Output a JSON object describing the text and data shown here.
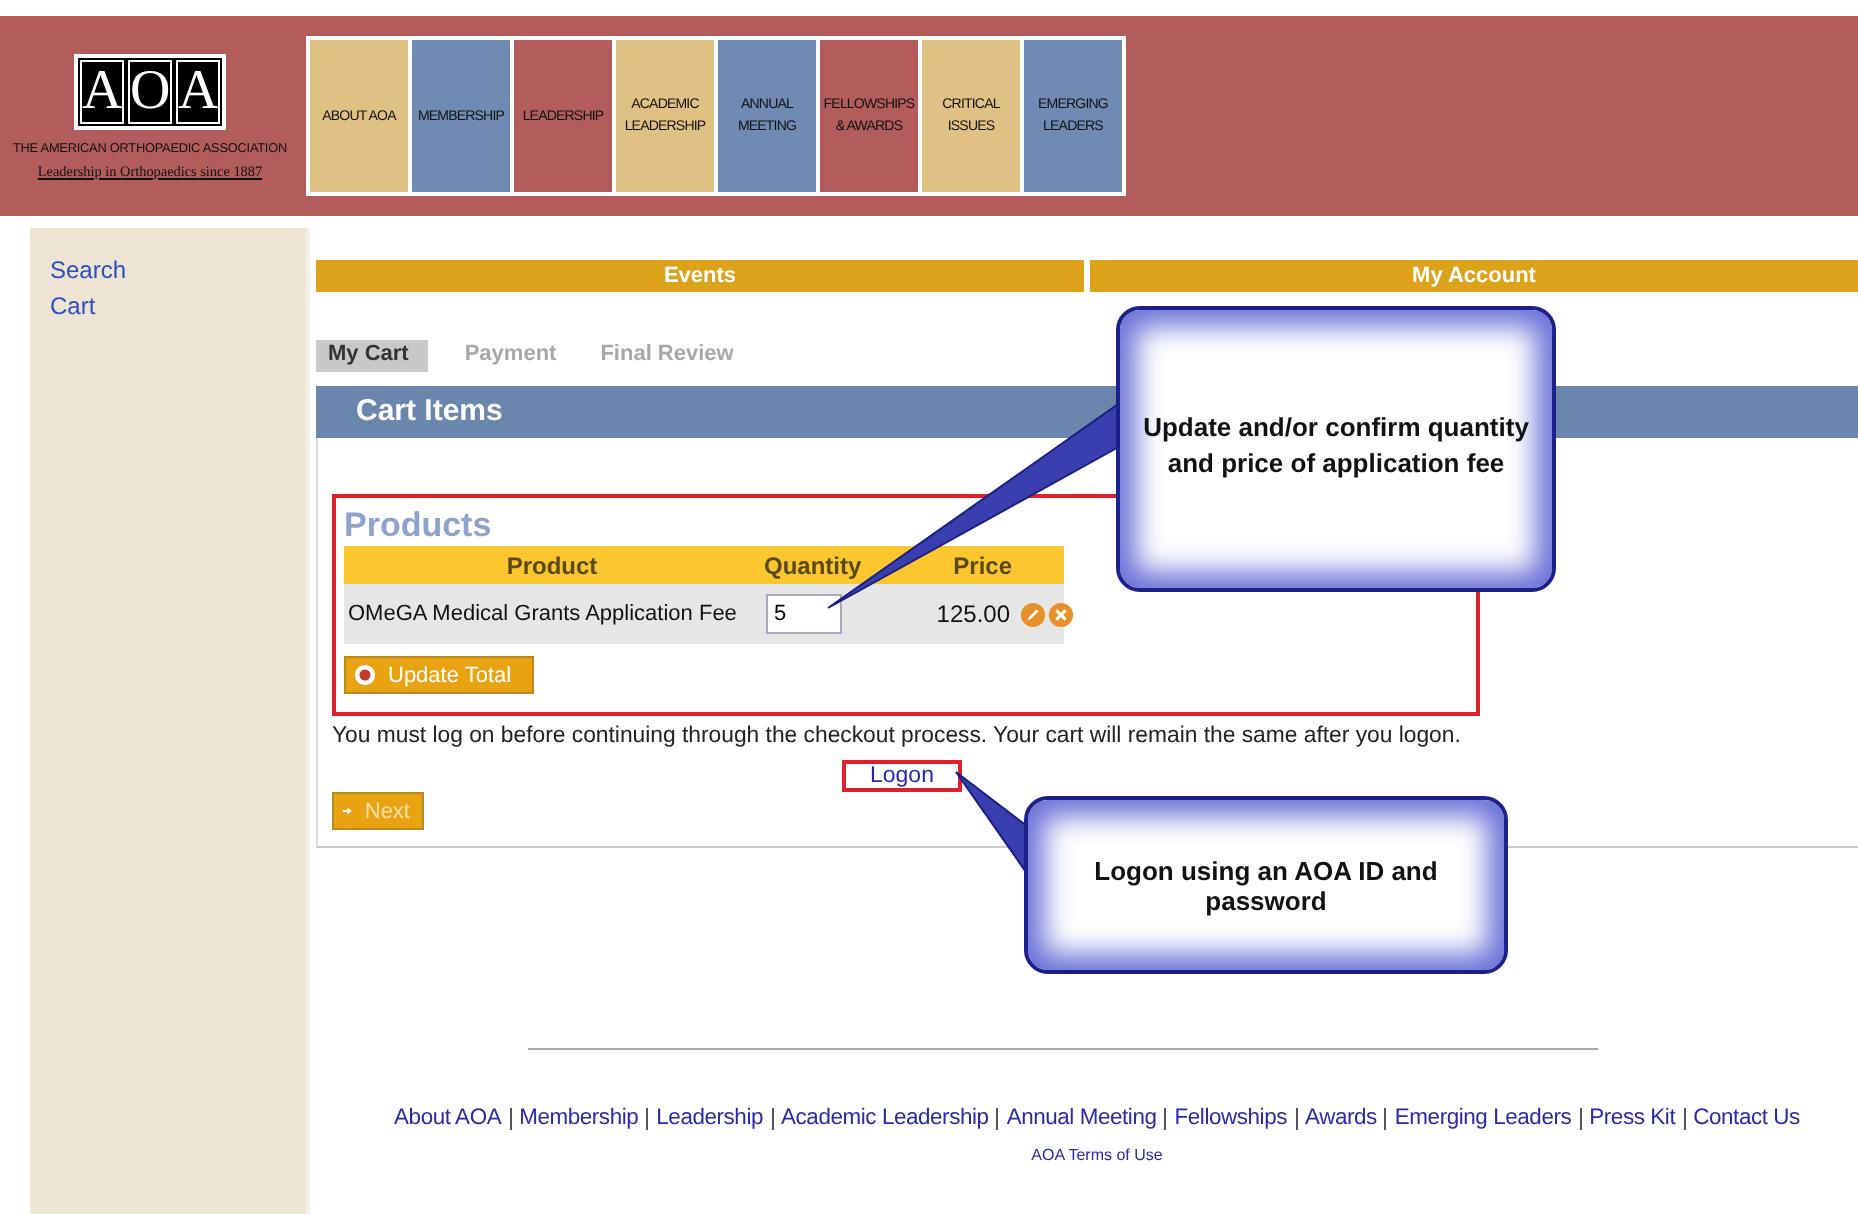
{
  "header": {
    "logo_letters": [
      "A",
      "O",
      "A"
    ],
    "org_name": "THE AMERICAN ORTHOPAEDIC ASSOCIATION",
    "tagline": "Leadership in Orthopaedics since 1887",
    "nav": [
      {
        "label": "ABOUT AOA",
        "color": "#dfc283"
      },
      {
        "label": "MEMBERSHIP",
        "color": "#6f8bb3"
      },
      {
        "label": "LEADERSHIP",
        "color": "#b35c5c"
      },
      {
        "label": "ACADEMIC LEADERSHIP",
        "color": "#dfc283"
      },
      {
        "label": "ANNUAL MEETING",
        "color": "#6f8bb3"
      },
      {
        "label": "FELLOWSHIPS & AWARDS",
        "color": "#b35c5c"
      },
      {
        "label": "CRITICAL ISSUES",
        "color": "#dfc283"
      },
      {
        "label": "EMERGING LEADERS",
        "color": "#6f8bb3"
      }
    ]
  },
  "sidebar": {
    "items": [
      {
        "label": "Search"
      },
      {
        "label": "Cart"
      }
    ]
  },
  "top_bar": [
    "Events",
    "My Account"
  ],
  "steps": [
    {
      "label": "My Cart",
      "selected": true
    },
    {
      "label": "Payment",
      "selected": false
    },
    {
      "label": "Final Review",
      "selected": false
    }
  ],
  "section_title": "Cart Items",
  "products": {
    "title": "Products",
    "columns": [
      "Product",
      "Quantity",
      "Price"
    ],
    "rows": [
      {
        "product": "OMeGA Medical Grants Application Fee",
        "quantity": "5",
        "price": "125.00"
      }
    ],
    "update_button": "Update Total"
  },
  "notice": "You must log on before continuing through the checkout process. Your cart will remain the same after you logon.",
  "logon_link": "Logon",
  "next_button": "Next",
  "callouts": [
    "Update and/or confirm quantity and price of application fee",
    "Logon using an AOA ID and password"
  ],
  "footer": {
    "links": [
      "About AOA",
      "Membership",
      "Leadership",
      "Academic Leadership",
      "Annual Meeting",
      "Fellowships",
      "Awards",
      "Emerging Leaders",
      "Press Kit",
      "Contact Us"
    ],
    "terms": "AOA Terms of Use"
  }
}
